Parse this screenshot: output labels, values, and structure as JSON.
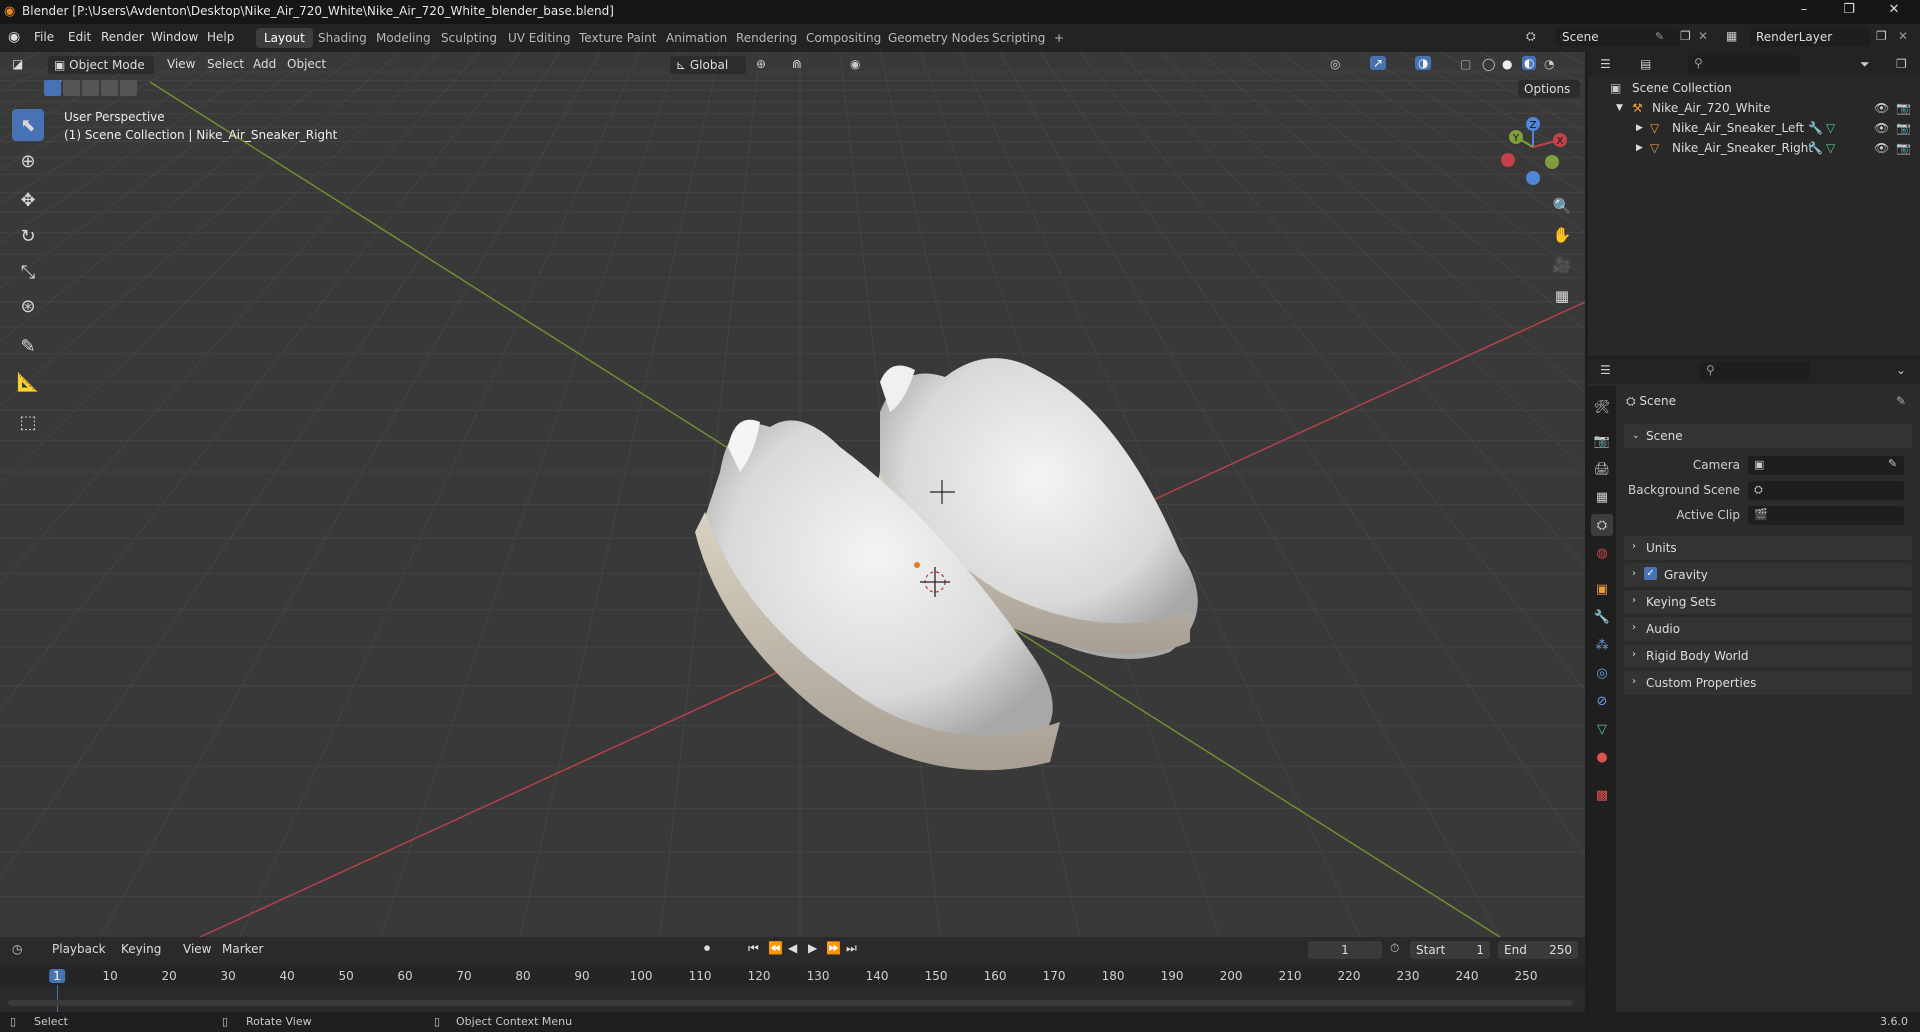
{
  "window": {
    "title": "Blender [P:\\Users\\Avdenton\\Desktop\\Nike_Air_720_White\\Nike_Air_720_White_blender_base.blend]",
    "minimize": "–",
    "maximize": "❐",
    "close": "✕"
  },
  "menu": [
    "File",
    "Edit",
    "Render",
    "Window",
    "Help"
  ],
  "workspaces": [
    "Layout",
    "Shading",
    "Modeling",
    "Sculpting",
    "UV Editing",
    "Texture Paint",
    "Animation",
    "Rendering",
    "Compositing",
    "Geometry Nodes",
    "Scripting"
  ],
  "workspace_add": "+",
  "scene_selector": "Scene",
  "view_layer": "RenderLayer",
  "viewport": {
    "mode": "Object Mode",
    "menus": [
      "View",
      "Select",
      "Add",
      "Object"
    ],
    "orientation": "Global",
    "options_label": "Options",
    "info_line1": "User Perspective",
    "info_line2": "(1) Scene Collection | Nike_Air_Sneaker_Right",
    "gizmo": {
      "x": "X",
      "y": "Y",
      "z": "Z"
    }
  },
  "outliner": {
    "root": "Scene Collection",
    "collection": "Nike_Air_720_White",
    "objects": [
      "Nike_Air_Sneaker_Left",
      "Nike_Air_Sneaker_Right"
    ]
  },
  "properties": {
    "context": "Scene",
    "panel_scene": "Scene",
    "camera_label": "Camera",
    "background_scene_label": "Background Scene",
    "active_clip_label": "Active Clip",
    "panels": [
      "Units",
      "Gravity",
      "Keying Sets",
      "Audio",
      "Rigid Body World",
      "Custom Properties"
    ],
    "gravity_checked": true
  },
  "timeline": {
    "menus": [
      "Playback",
      "Keying",
      "View",
      "Marker"
    ],
    "current_frame": "1",
    "start_label": "Start",
    "start": "1",
    "end_label": "End",
    "end": "250",
    "ticks": [
      "1",
      "10",
      "20",
      "30",
      "40",
      "50",
      "60",
      "70",
      "80",
      "90",
      "100",
      "110",
      "120",
      "130",
      "140",
      "150",
      "160",
      "170",
      "180",
      "190",
      "200",
      "210",
      "220",
      "230",
      "240",
      "250"
    ]
  },
  "statusbar": {
    "select": "Select",
    "rotate": "Rotate View",
    "context_menu": "Object Context Menu",
    "version": "3.6.0"
  },
  "colors": {
    "accent": "#4772b3",
    "x_axis": "#c4404a",
    "y_axis": "#7ea03a",
    "z_axis": "#4f86d6"
  }
}
